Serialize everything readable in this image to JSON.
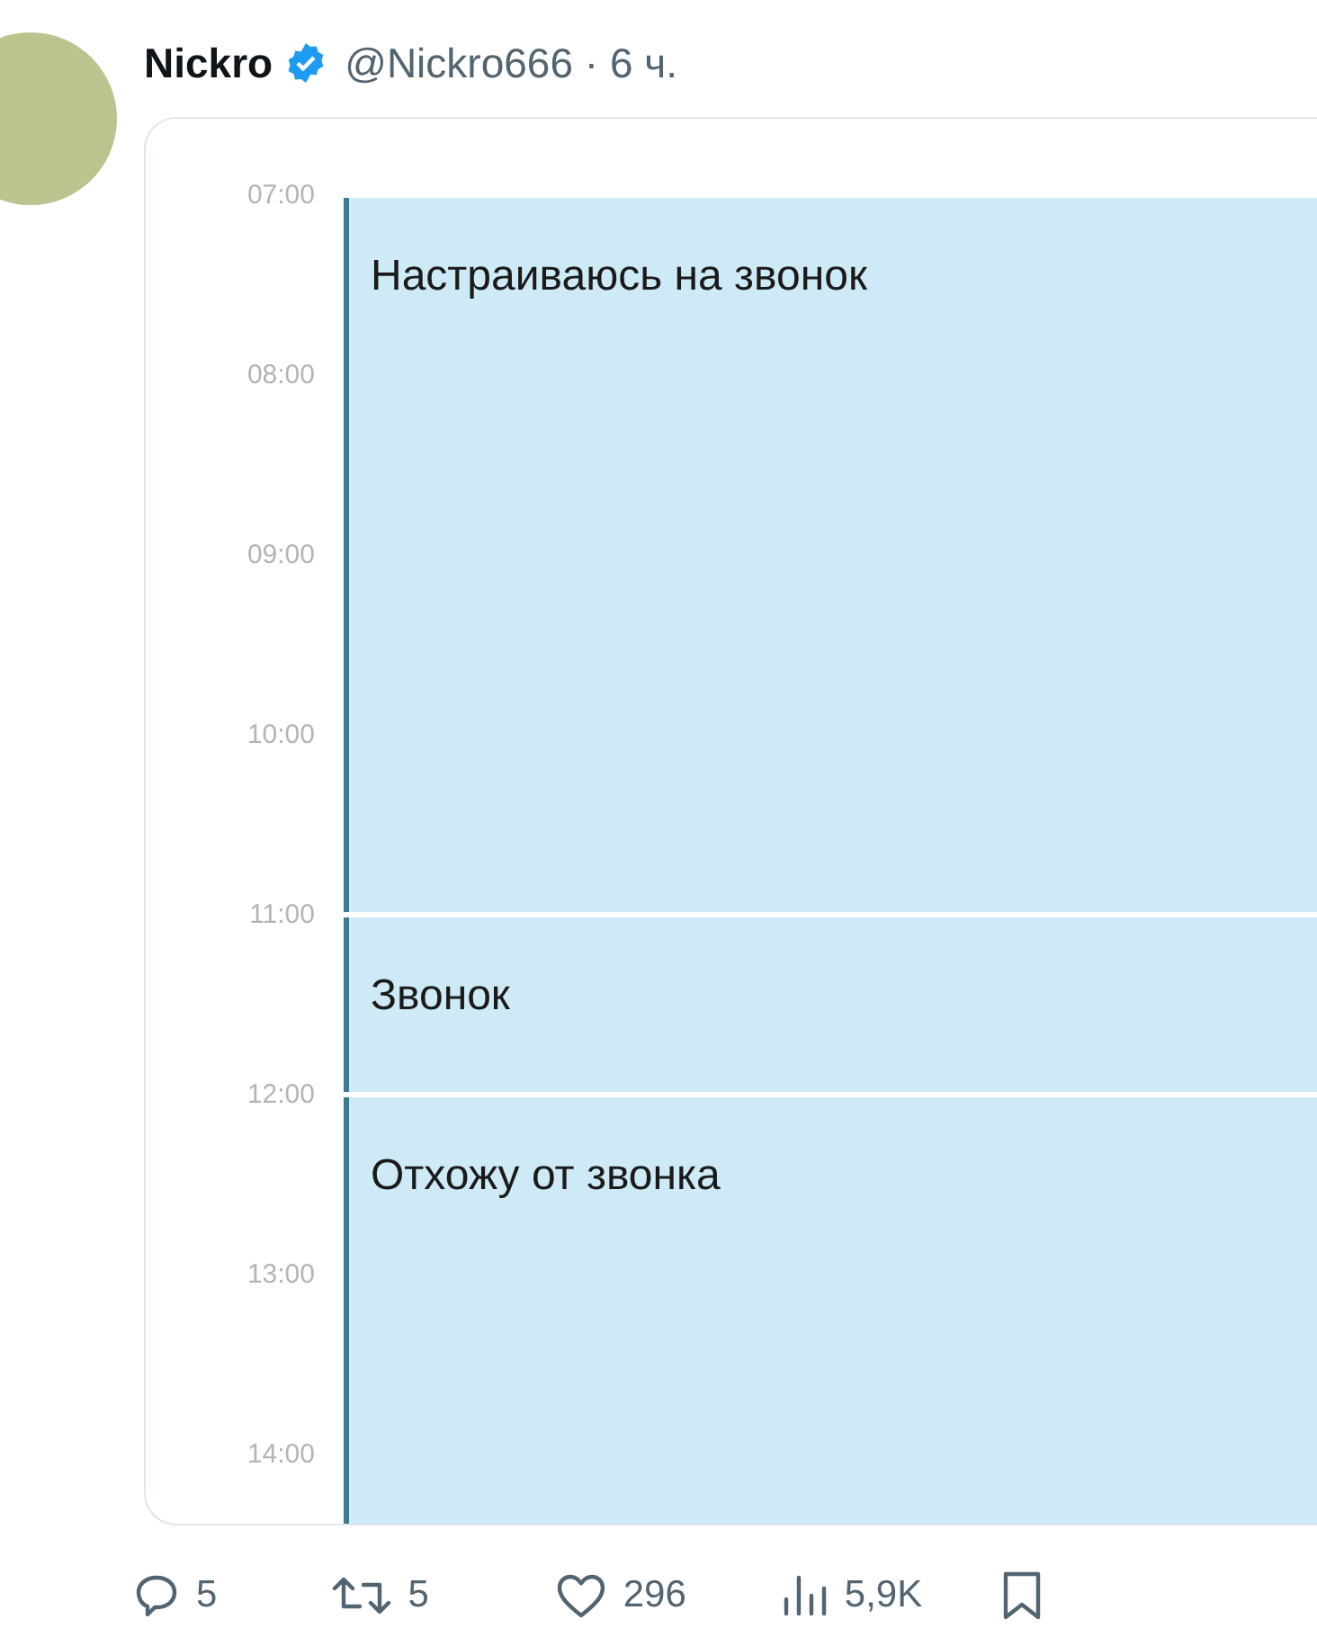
{
  "post": {
    "author": "Nickro",
    "verified": true,
    "handle": "@Nickro666",
    "separator": "·",
    "time": "6 ч."
  },
  "calendar": {
    "hours": [
      "07:00",
      "08:00",
      "09:00",
      "10:00",
      "11:00",
      "12:00",
      "13:00",
      "14:00"
    ],
    "events": [
      {
        "title": "Настраиваюсь на звонок"
      },
      {
        "title": "Звонок"
      },
      {
        "title": "Отхожу от звонка"
      }
    ]
  },
  "actions": [
    {
      "kind": "reply",
      "count": "5"
    },
    {
      "kind": "repost",
      "count": "5"
    },
    {
      "kind": "like",
      "count": "296"
    },
    {
      "kind": "views",
      "count": "5,9K"
    },
    {
      "kind": "bookmark"
    }
  ]
}
